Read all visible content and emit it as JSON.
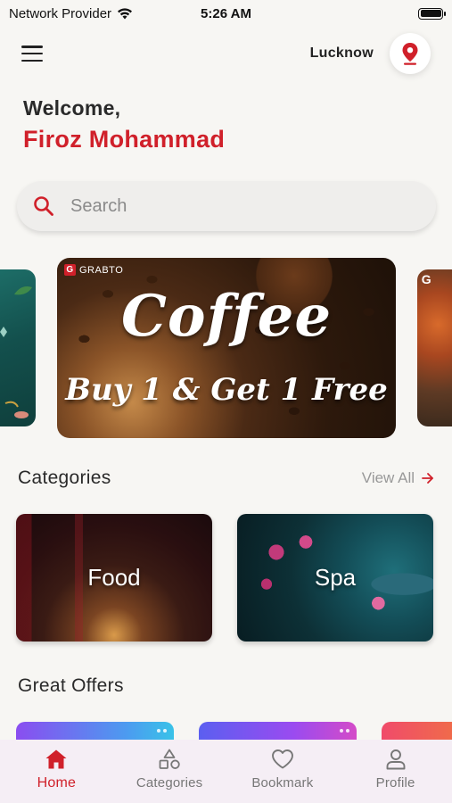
{
  "status_bar": {
    "carrier": "Network Provider",
    "time": "5:26 AM",
    "battery_level": 1.0
  },
  "header": {
    "city": "Lucknow",
    "menu_icon": "hamburger-icon",
    "location_icon": "map-pin-icon"
  },
  "greeting": {
    "welcome": "Welcome,",
    "name": "Firoz Mohammad"
  },
  "search": {
    "placeholder": "Search",
    "icon": "search-icon"
  },
  "banner": {
    "brand": "GRABTO",
    "title": "Coffee",
    "subtitle": "Buy 1 & Get 1 Free",
    "side_right_brand": "G"
  },
  "categories": {
    "title": "Categories",
    "view_all": "View All",
    "items": [
      {
        "label": "Food"
      },
      {
        "label": "Spa"
      }
    ]
  },
  "offers": {
    "title": "Great Offers"
  },
  "bottom_nav": {
    "items": [
      {
        "label": "Home",
        "icon": "home-icon",
        "active": true
      },
      {
        "label": "Categories",
        "icon": "shapes-icon",
        "active": false
      },
      {
        "label": "Bookmark",
        "icon": "heart-icon",
        "active": false
      },
      {
        "label": "Profile",
        "icon": "user-icon",
        "active": false
      }
    ]
  },
  "colors": {
    "accent": "#d0202a",
    "background": "#f7f6f3",
    "nav_background": "#f5eef5"
  }
}
